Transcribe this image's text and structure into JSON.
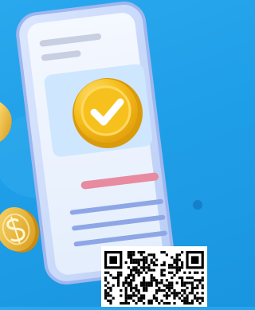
{
  "scene": {
    "colors": {
      "background": "#1f9fe8",
      "phone_frame": "#c9d9f8",
      "phone_screen": "#eaf3ff",
      "hero_card": "#cfe6ff",
      "badge_gold": "#f6c01d",
      "badge_gold_dark": "#e6a50e",
      "checkmark": "#ffffff",
      "pink_bar": "#e88aa0",
      "line_gray": "#c8cfe0",
      "line_blue": "#8fa6e6",
      "coin": "#f3c44a",
      "qr_dark": "#000000",
      "qr_light": "#ffffff"
    },
    "icons": {
      "check_badge": "check-circle-icon",
      "coin": "dollar-coin-icon",
      "qr": "qr-code-icon"
    }
  }
}
